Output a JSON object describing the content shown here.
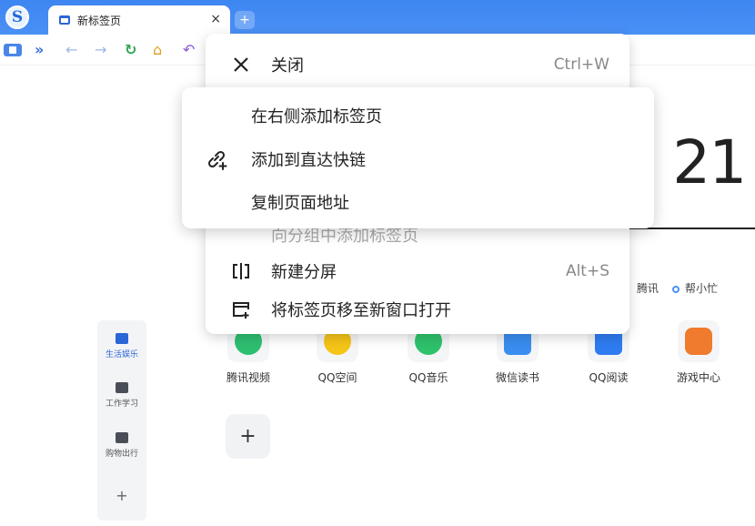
{
  "tab": {
    "title": "新标签页",
    "close": "×"
  },
  "newtab": "+",
  "clock": {
    "text": "21",
    "prefix": ":"
  },
  "links": {
    "tencent": "腾讯",
    "helper": "帮小忙"
  },
  "leftnav": {
    "items": [
      {
        "label": "生活娱乐",
        "active": true
      },
      {
        "label": "工作学习",
        "active": false
      },
      {
        "label": "购物出行",
        "active": false
      }
    ],
    "add": "+"
  },
  "apps": [
    {
      "label": "腾讯视频",
      "color": "#2fbf71"
    },
    {
      "label": "QQ空间",
      "color": "#f5c518"
    },
    {
      "label": "QQ音乐",
      "color": "#2ec26b"
    },
    {
      "label": "微信读书",
      "color": "#3a8ef0"
    },
    {
      "label": "QQ阅读",
      "color": "#2f7cf2"
    },
    {
      "label": "游戏中心",
      "color": "#f07a2e"
    }
  ],
  "add_app": "+",
  "menu": {
    "close": {
      "label": "关闭",
      "shortcut": "Ctrl+W"
    },
    "add_to_group": {
      "label": "向分组中添加标签页"
    },
    "split": {
      "label": "新建分屏",
      "shortcut": "Alt+S"
    },
    "move_window": {
      "label": "将标签页移至新窗口打开"
    }
  },
  "submenu": {
    "add_right": "在右侧添加标签页",
    "add_quicklink": "添加到直达快链",
    "copy_url": "复制页面地址"
  }
}
